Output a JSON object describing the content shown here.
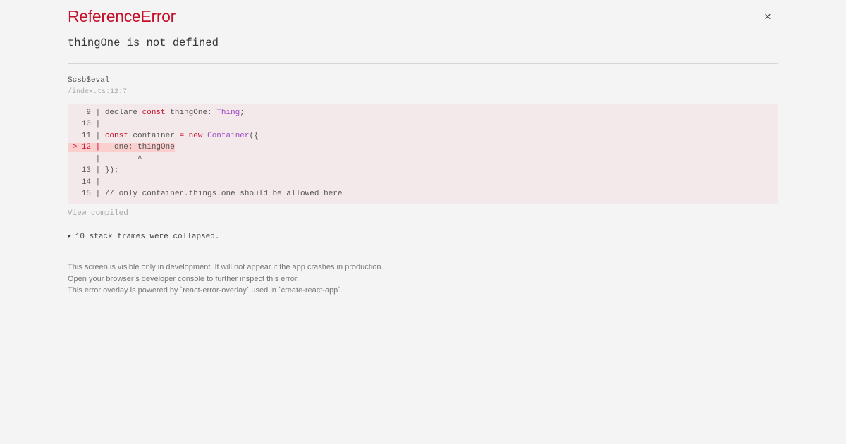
{
  "header": {
    "error_type": "ReferenceError",
    "close_glyph": "×",
    "message": "thingOne is not defined"
  },
  "frame": {
    "function_name": "$csb$eval",
    "location": "/index.ts:12:7"
  },
  "code": {
    "lines": [
      {
        "gutter": "    9 | ",
        "tokens": [
          {
            "t": "declare ",
            "c": ""
          },
          {
            "t": "const",
            "c": "kw"
          },
          {
            "t": " thingOne: ",
            "c": ""
          },
          {
            "t": "Thing",
            "c": "ty"
          },
          {
            "t": ";",
            "c": ""
          }
        ]
      },
      {
        "gutter": "   10 | ",
        "tokens": []
      },
      {
        "gutter": "   11 | ",
        "tokens": [
          {
            "t": "const",
            "c": "kw"
          },
          {
            "t": " container ",
            "c": ""
          },
          {
            "t": "=",
            "c": "kw"
          },
          {
            "t": " ",
            "c": ""
          },
          {
            "t": "new",
            "c": "kw"
          },
          {
            "t": " ",
            "c": ""
          },
          {
            "t": "Container",
            "c": "ty"
          },
          {
            "t": "({",
            "c": ""
          }
        ]
      },
      {
        "gutter": " > 12 | ",
        "tokens": [
          {
            "t": "  one: thingOne",
            "c": ""
          }
        ],
        "highlight": true
      },
      {
        "gutter": "      | ",
        "tokens": [
          {
            "t": "       ^",
            "c": ""
          }
        ]
      },
      {
        "gutter": "   13 | ",
        "tokens": [
          {
            "t": "});",
            "c": ""
          }
        ]
      },
      {
        "gutter": "   14 | ",
        "tokens": []
      },
      {
        "gutter": "   15 | ",
        "tokens": [
          {
            "t": "// only container.things.one should be allowed here",
            "c": ""
          }
        ]
      }
    ]
  },
  "view_compiled": "View compiled",
  "stack_toggle": "10 stack frames were collapsed.",
  "footer": {
    "line1": "This screen is visible only in development. It will not appear if the app crashes in production.",
    "line2": "Open your browser’s developer console to further inspect this error.",
    "line3": "This error overlay is powered by `react-error-overlay` used in `create-react-app`."
  },
  "colors": {
    "error_red": "#c6102b",
    "type_purple": "#a04cc6",
    "code_bg": "#f3e9ea",
    "highlight_bg": "#fccfcf"
  }
}
